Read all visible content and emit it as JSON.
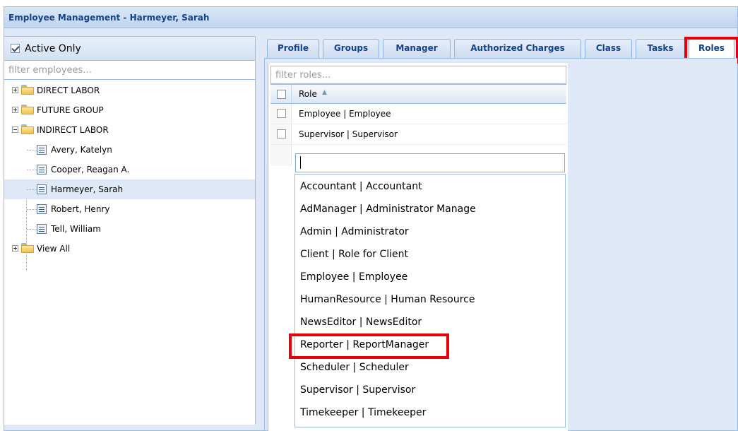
{
  "window": {
    "title": "Employee Management - Harmeyer, Sarah"
  },
  "left_panel": {
    "active_only_label": "Active Only",
    "active_only_checked": true,
    "filter_placeholder": "filter employees...",
    "tree": [
      {
        "label": "DIRECT LABOR",
        "type": "folder",
        "expanded": false
      },
      {
        "label": "FUTURE GROUP",
        "type": "folder",
        "expanded": false
      },
      {
        "label": "INDIRECT LABOR",
        "type": "folder",
        "expanded": true
      },
      {
        "label": "Avery, Katelyn",
        "type": "employee"
      },
      {
        "label": "Cooper, Reagan A.",
        "type": "employee"
      },
      {
        "label": "Harmeyer, Sarah",
        "type": "employee",
        "selected": true
      },
      {
        "label": "Robert, Henry",
        "type": "employee"
      },
      {
        "label": "Tell, William",
        "type": "employee"
      },
      {
        "label": "View All",
        "type": "folder",
        "expanded": false
      }
    ]
  },
  "tabs": [
    {
      "label": "Profile"
    },
    {
      "label": "Groups"
    },
    {
      "label": "Manager"
    },
    {
      "label": "Authorized Charges"
    },
    {
      "label": "Class"
    },
    {
      "label": "Tasks"
    },
    {
      "label": "Roles",
      "active": true
    }
  ],
  "roles_grid": {
    "filter_placeholder": "filter roles...",
    "column_header": "Role",
    "sort_indicator": "▲",
    "rows": [
      {
        "label": "Employee | Employee"
      },
      {
        "label": "Supervisor | Supervisor"
      }
    ],
    "new_role_input_value": ""
  },
  "role_dropdown": {
    "options": [
      "Accountant | Accountant",
      "AdManager | Administrator Manage",
      "Admin | Administrator",
      "Client | Role for Client",
      "Employee | Employee",
      "HumanResource | Human Resource",
      "NewsEditor | NewsEditor",
      "Reporter | ReportManager",
      "Scheduler | Scheduler",
      "Supervisor | Supervisor",
      "Timekeeper | Timekeeper"
    ],
    "highlighted_option": "Reporter | ReportManager"
  },
  "colors": {
    "highlight_border": "#e8000b",
    "panel_border": "#99bbe8",
    "tab_text": "#15428b"
  },
  "icons": {
    "folder": "folder-icon",
    "employee": "employee-card-icon",
    "expander_plus": "expand-plus-icon",
    "expander_minus": "collapse-minus-icon"
  }
}
